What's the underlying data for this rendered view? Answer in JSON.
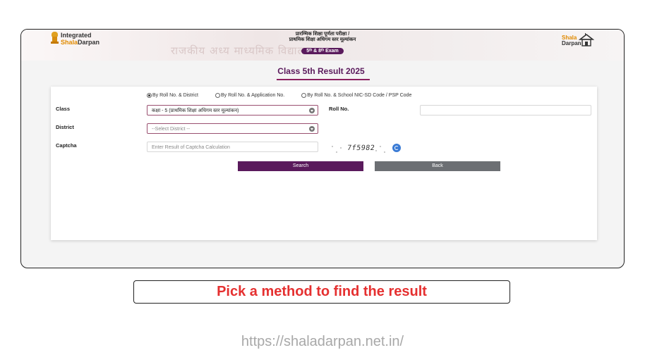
{
  "header": {
    "logo_left_line1": "Integrated",
    "logo_left_line2_prefix": "Shala",
    "logo_left_line2_suffix": "Darpan",
    "background_text": "राजकीय अध्य माध्यमिक विद्यालय",
    "title_line1": "प्रारम्भिक शिक्षा पूर्णता परीक्षा /",
    "title_line2": "प्राथमिक शिक्षा अधिगम स्तर मूल्यांकन",
    "exam_badge": "5ᵗʰ & 8ᵗʰ Exam",
    "logo_right_line1_prefix": "Shala",
    "logo_right_line2": "Darpan",
    "icon": "school-house-icon"
  },
  "page_title": "Class 5th Result 2025",
  "form": {
    "radios": [
      {
        "label": "By Roll No. & District",
        "selected": true
      },
      {
        "label": "By Roll No. & Application No.",
        "selected": false
      },
      {
        "label": "By Roll No. & School NIC-SD Code / PSP Code",
        "selected": false
      }
    ],
    "class_label": "Class",
    "class_value": "कक्षा - 5 (प्राथमिक शिक्षा अधिगम स्तर मूल्यांकन)",
    "roll_label": "Roll No.",
    "roll_value": "",
    "district_label": "District",
    "district_value": "--Select District --",
    "captcha_label": "Captcha",
    "captcha_placeholder": "Enter Result of Captcha Calculation",
    "captcha_code": "7f5982",
    "search_label": "Search",
    "back_label": "Back"
  },
  "callout": "Pick a method to find the result",
  "url": "https://shaladarpan.net.in/",
  "colors": {
    "brand": "#5a1a5c",
    "callout": "#e53030",
    "accent": "#e08a00"
  }
}
